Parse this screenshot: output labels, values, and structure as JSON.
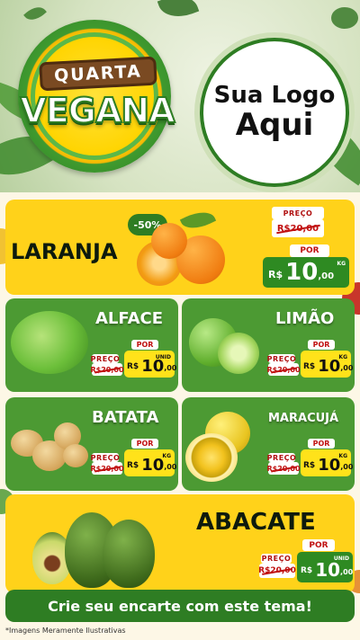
{
  "header": {
    "badge_top": "QUARTA",
    "badge_main": "VEGANA",
    "logo_line1": "Sua Logo",
    "logo_line2": "Aqui"
  },
  "products": [
    {
      "name": "LARANJA",
      "discount": "-50%",
      "label_preco": "PREÇO",
      "old_price": "R$20,00",
      "label_por": "POR",
      "currency": "R$",
      "price_int": "10",
      "price_dec": ",00",
      "unit": "KG"
    },
    {
      "name": "ALFACE",
      "label_preco": "PREÇO",
      "old_price": "R$20,00",
      "label_por": "POR",
      "currency": "R$",
      "price_int": "10",
      "price_dec": ",00",
      "unit": "UNID"
    },
    {
      "name": "LIMÃO",
      "label_preco": "PREÇO",
      "old_price": "R$20,00",
      "label_por": "POR",
      "currency": "R$",
      "price_int": "10",
      "price_dec": ",00",
      "unit": "KG"
    },
    {
      "name": "BATATA",
      "label_preco": "PREÇO",
      "old_price": "R$20,00",
      "label_por": "POR",
      "currency": "R$",
      "price_int": "10",
      "price_dec": ",00",
      "unit": "KG"
    },
    {
      "name": "MARACUJÁ",
      "label_preco": "PREÇO",
      "old_price": "R$20,00",
      "label_por": "POR",
      "currency": "R$",
      "price_int": "10",
      "price_dec": ",00",
      "unit": "KG"
    },
    {
      "name": "ABACATE",
      "label_preco": "PREÇO",
      "old_price": "R$20,00",
      "label_por": "POR",
      "currency": "R$",
      "price_int": "10",
      "price_dec": ",00",
      "unit": "UNID"
    }
  ],
  "footer": {
    "cta": "Crie seu encarte com este tema!",
    "disclaimer": "*Imagens Meramente Ilustrativas"
  },
  "colors": {
    "brand_green": "#2e7d23",
    "card_green": "#4c9a33",
    "accent_yellow": "#ffd21a",
    "price_red": "#c01010"
  }
}
